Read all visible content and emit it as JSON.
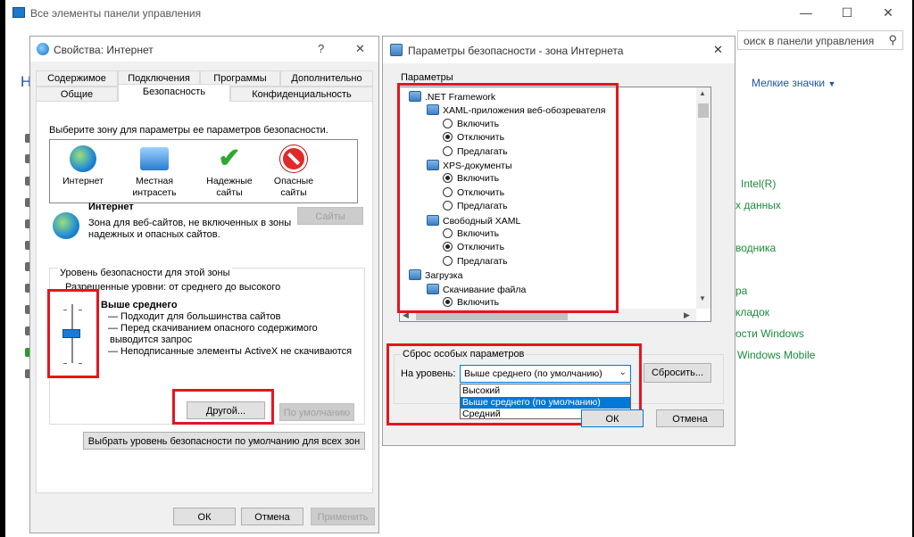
{
  "control_panel": {
    "title": "Все элементы панели управления",
    "search_placeholder": "оиск в панели управления",
    "heading_initial": "Н",
    "view_label": "Мелкие значки",
    "minimize": "—",
    "maximize": "☐",
    "close": "✕",
    "right_items": [
      "Intel(R)",
      "х данных",
      "водника",
      "ра",
      "кладок",
      "ости Windows",
      "Windows Mobile"
    ]
  },
  "internet_properties": {
    "title": "Свойства: Интернет",
    "help": "?",
    "close": "✕",
    "tabs_row1": [
      "Содержимое",
      "Подключения",
      "Программы",
      "Дополнительно"
    ],
    "tabs_row2": [
      "Общие",
      "Безопасность",
      "Конфиденциальность"
    ],
    "zone_prompt": "Выберите зону для параметры ее параметров безопасности.",
    "zones": [
      {
        "label1": "Интернет",
        "label2": ""
      },
      {
        "label1": "Местная",
        "label2": "интрасеть"
      },
      {
        "label1": "Надежные",
        "label2": "сайты"
      },
      {
        "label1": "Опасные",
        "label2": "сайты"
      }
    ],
    "zone_title": "Интернет",
    "zone_desc1": "Зона для веб-сайтов, не включенных в зоны",
    "zone_desc2": "надежных и опасных сайтов.",
    "sites_button": "Сайты",
    "level_group": "Уровень безопасности для этой зоны",
    "allowed_levels": "Разрешенные уровни: от среднего до высокого",
    "level_name": "Выше среднего",
    "level_lines": [
      "— Подходит для большинства сайтов",
      "— Перед скачиванием опасного содержимого",
      "выводится запрос",
      "— Неподписанные элементы ActiveX не скачиваются"
    ],
    "custom_button": "Другой...",
    "default_button": "По умолчанию",
    "reset_all_button": "Выбрать уровень безопасности по умолчанию для всех зон",
    "ok": "ОК",
    "cancel": "Отмена",
    "apply": "Применить"
  },
  "security_settings": {
    "title": "Параметры безопасности - зона Интернета",
    "close": "✕",
    "params_label": "Параметры",
    "tree": [
      {
        "type": "group",
        "label": ".NET Framework",
        "indent": 0
      },
      {
        "type": "group",
        "label": "XAML-приложения веб-обозревателя",
        "indent": 1
      },
      {
        "type": "radio",
        "label": "Включить",
        "on": false,
        "indent": 2
      },
      {
        "type": "radio",
        "label": "Отключить",
        "on": true,
        "indent": 2
      },
      {
        "type": "radio",
        "label": "Предлагать",
        "on": false,
        "indent": 2
      },
      {
        "type": "group",
        "label": "XPS-документы",
        "indent": 1
      },
      {
        "type": "radio",
        "label": "Включить",
        "on": true,
        "indent": 2
      },
      {
        "type": "radio",
        "label": "Отключить",
        "on": false,
        "indent": 2
      },
      {
        "type": "radio",
        "label": "Предлагать",
        "on": false,
        "indent": 2
      },
      {
        "type": "group",
        "label": "Свободный XAML",
        "indent": 1
      },
      {
        "type": "radio",
        "label": "Включить",
        "on": false,
        "indent": 2
      },
      {
        "type": "radio",
        "label": "Отключить",
        "on": true,
        "indent": 2
      },
      {
        "type": "radio",
        "label": "Предлагать",
        "on": false,
        "indent": 2
      },
      {
        "type": "group",
        "label": "Загрузка",
        "indent": 0
      },
      {
        "type": "group",
        "label": "Скачивание файла",
        "indent": 1
      },
      {
        "type": "radio",
        "label": "Включить",
        "on": true,
        "indent": 2
      }
    ],
    "reset_group": "Сброс особых параметров",
    "reset_to_label": "На уровень:",
    "dropdown_value": "Выше среднего (по умолчанию)",
    "dropdown_options": [
      "Высокий",
      "Выше среднего (по умолчанию)",
      "Средний"
    ],
    "reset_button": "Сбросить...",
    "ok": "ОК",
    "cancel": "Отмена"
  },
  "colors": {
    "highlight": "#e3161f",
    "accent": "#0078d7",
    "link_green": "#1b8a3c"
  }
}
